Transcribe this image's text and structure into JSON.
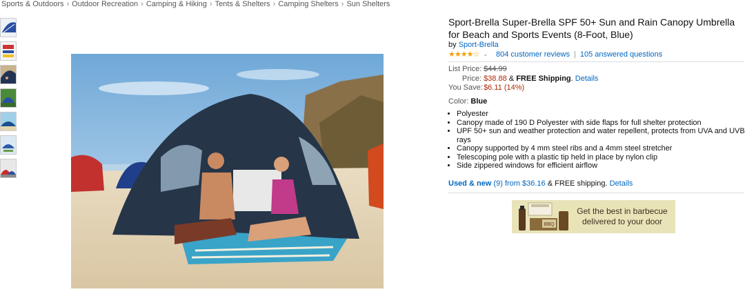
{
  "breadcrumb": [
    "Sports & Outdoors",
    "Outdoor Recreation",
    "Camping & Hiking",
    "Tents & Shelters",
    "Camping Shelters",
    "Sun Shelters"
  ],
  "breadcrumb_separator": "›",
  "product": {
    "title": "Sport-Brella Super-Brella SPF 50+ Sun and Rain Canopy Umbrella for Beach and Sports Events (8-Foot, Blue)",
    "by_label": "by",
    "brand": "Sport-Brella",
    "stars": "★★★★☆",
    "rating_caret": "⌄",
    "reviews": "804 customer reviews",
    "rating_separator": "|",
    "questions": "105 answered questions"
  },
  "pricing": {
    "list_label": "List Price:",
    "list_price": "$44.99",
    "price_label": "Price:",
    "price": "$38.88",
    "shipping_prefix": "&",
    "shipping": "FREE Shipping",
    "shipping_dot": ".",
    "details": "Details",
    "save_label": "You Save:",
    "save": "$6.11 (14%)"
  },
  "color": {
    "label": "Color:",
    "value": "Blue"
  },
  "bullets": [
    "Polyester",
    "Canopy made of 190 D Polyester with side flaps for full shelter protection",
    "UPF 50+ sun and weather protection and water repellent, protects from UVA and UVB rays",
    "Canopy supported by 4 mm steel ribs and a 4mm steel stretcher",
    "Telescoping pole with a plastic tip held in place by nylon clip",
    "Side zippered windows for efficient airflow"
  ],
  "used_new": {
    "label": "Used & new",
    "count": "(9)",
    "from": "from $36.16",
    "shipping": "& FREE shipping.",
    "details": "Details"
  },
  "ad": {
    "text": "Get the best in barbecue delivered to your door",
    "jar_label": "BBQ"
  },
  "colors": {
    "link": "#0066c0",
    "price_red": "#b12704",
    "star": "#f0a000",
    "ad_bg": "#e9e3b8"
  }
}
